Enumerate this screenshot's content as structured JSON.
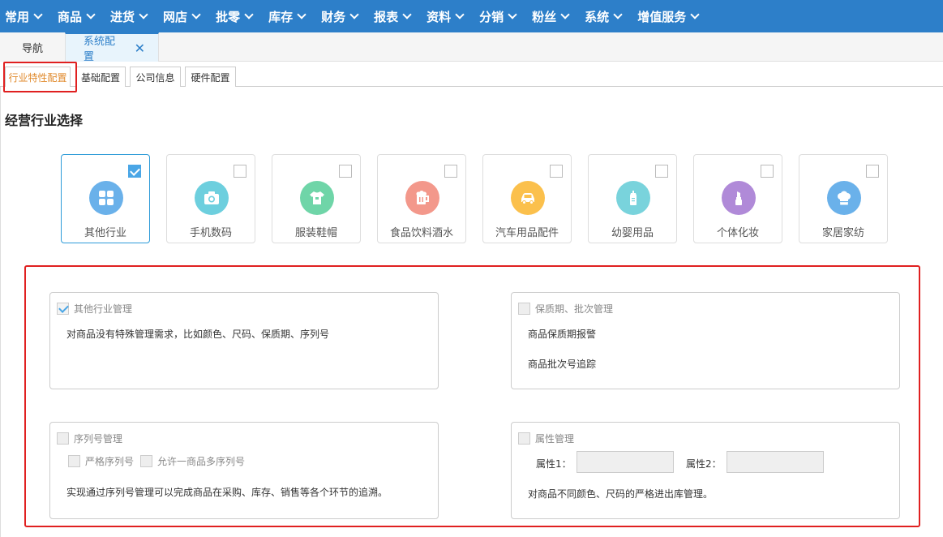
{
  "topnav": {
    "items": [
      "常用",
      "商品",
      "进货",
      "网店",
      "批零",
      "库存",
      "财务",
      "报表",
      "资料",
      "分销",
      "粉丝",
      "系统",
      "增值服务"
    ]
  },
  "pagetabs": {
    "nav_label": "导航",
    "active_label": "系统配置",
    "close_glyph": "✕"
  },
  "subtabs": [
    "行业特性配置",
    "基础配置",
    "公司信息",
    "硬件配置"
  ],
  "section_title": "经营行业选择",
  "industries": [
    {
      "label": "其他行业",
      "icon": "grid-icon",
      "color": "#6ab1ea",
      "selected": true
    },
    {
      "label": "手机数码",
      "icon": "camera-icon",
      "color": "#6dcfde",
      "selected": false
    },
    {
      "label": "服装鞋帽",
      "icon": "shirt-icon",
      "color": "#6fd5a8",
      "selected": false
    },
    {
      "label": "食品饮料酒水",
      "icon": "beer-icon",
      "color": "#f3988b",
      "selected": false
    },
    {
      "label": "汽车用品配件",
      "icon": "car-icon",
      "color": "#fbc04c",
      "selected": false
    },
    {
      "label": "幼婴用品",
      "icon": "bottle-icon",
      "color": "#79d3dc",
      "selected": false
    },
    {
      "label": "个体化妆",
      "icon": "lipstick-icon",
      "color": "#b08ad8",
      "selected": false
    },
    {
      "label": "家居家纺",
      "icon": "chef-hat-icon",
      "color": "#6ab1ea",
      "selected": false
    }
  ],
  "panels": {
    "other": {
      "title": "其他行业管理",
      "desc": "对商品没有特殊管理需求，比如颜色、尺码、保质期、序列号",
      "checked": true
    },
    "shelf": {
      "title": "保质期、批次管理",
      "line1": "商品保质期报警",
      "line2": "商品批次号追踪",
      "checked": false
    },
    "serial": {
      "title": "序列号管理",
      "opt1": "严格序列号",
      "opt2": "允许一商品多序列号",
      "desc": "实现通过序列号管理可以完成商品在采购、库存、销售等各个环节的追溯。",
      "checked": false
    },
    "attr": {
      "title": "属性管理",
      "attr1_label": "属性1：",
      "attr2_label": "属性2：",
      "attr1_value": "",
      "attr2_value": "",
      "desc": "对商品不同颜色、尺码的严格进出库管理。",
      "checked": false
    }
  }
}
